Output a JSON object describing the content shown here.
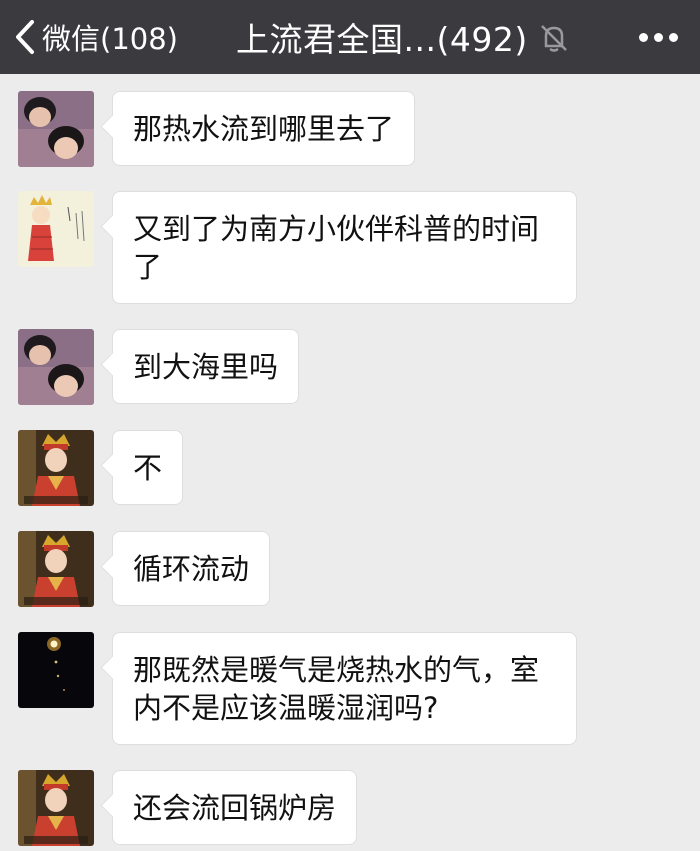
{
  "header": {
    "back_label": "微信(108)",
    "title": "上流君全国...(492)",
    "back_icon": "chevron-left-icon",
    "mute_icon": "mute-bell-icon",
    "more_icon": "more-dots-icon"
  },
  "colors": {
    "header_bg": "#3b3a3f",
    "chat_bg": "#ececec",
    "bubble_bg": "#ffffff"
  },
  "messages": [
    {
      "avatar": "avatar-boy",
      "text": "那热水流到哪里去了"
    },
    {
      "avatar": "avatar-cartoon-monk",
      "text": "又到了为南方小伙伴科普的时间了"
    },
    {
      "avatar": "avatar-boy",
      "text": "到大海里吗"
    },
    {
      "avatar": "avatar-monk",
      "text": "不"
    },
    {
      "avatar": "avatar-monk",
      "text": "循环流动"
    },
    {
      "avatar": "avatar-night-light",
      "text": "那既然是暖气是烧热水的气，室内不是应该温暖湿润吗?"
    },
    {
      "avatar": "avatar-monk",
      "text": "还会流回锅炉房"
    }
  ]
}
